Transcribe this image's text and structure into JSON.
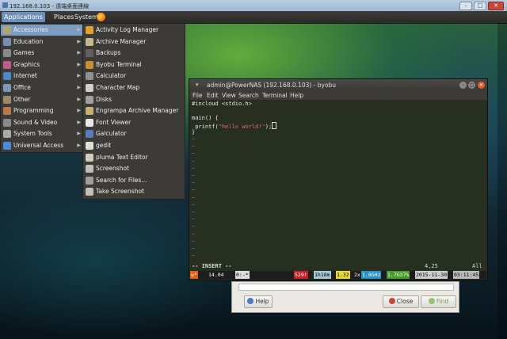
{
  "window": {
    "title": "192.168.0.103 - 遠端桌面連線"
  },
  "top_panel": {
    "applications": "Applications",
    "places": "Places",
    "system": "System"
  },
  "menu": {
    "categories": [
      {
        "label": "Accessories",
        "icon": "accessories-icon",
        "color": "#b0a27a"
      },
      {
        "label": "Education",
        "icon": "education-icon",
        "color": "#7a8fb0"
      },
      {
        "label": "Games",
        "icon": "games-icon",
        "color": "#8a8a8a"
      },
      {
        "label": "Graphics",
        "icon": "graphics-icon",
        "color": "#c05a8a"
      },
      {
        "label": "Internet",
        "icon": "internet-icon",
        "color": "#4a8ac8"
      },
      {
        "label": "Office",
        "icon": "office-icon",
        "color": "#7a9ab8"
      },
      {
        "label": "Other",
        "icon": "other-icon",
        "color": "#9a8a6a"
      },
      {
        "label": "Programming",
        "icon": "programming-icon",
        "color": "#b87a4a"
      },
      {
        "label": "Sound & Video",
        "icon": "sound-video-icon",
        "color": "#8a8a8a"
      },
      {
        "label": "System Tools",
        "icon": "system-tools-icon",
        "color": "#aaaaaa"
      },
      {
        "label": "Universal Access",
        "icon": "universal-access-icon",
        "color": "#4a8ad8"
      }
    ],
    "accessories": [
      {
        "label": "Activity Log Manager",
        "icon": "activity-log-icon",
        "color": "#e0a030"
      },
      {
        "label": "Archive Manager",
        "icon": "archive-icon",
        "color": "#c8b890"
      },
      {
        "label": "Backups",
        "icon": "backups-icon",
        "color": "#606060"
      },
      {
        "label": "Byobu Terminal",
        "icon": "terminal-icon",
        "color": "#c89030"
      },
      {
        "label": "Calculator",
        "icon": "calculator-icon",
        "color": "#909090"
      },
      {
        "label": "Character Map",
        "icon": "character-map-icon",
        "color": "#d0d0d0"
      },
      {
        "label": "Disks",
        "icon": "disks-icon",
        "color": "#a0a0a0"
      },
      {
        "label": "Engrampa Archive Manager",
        "icon": "engrampa-icon",
        "color": "#c8b070"
      },
      {
        "label": "Font Viewer",
        "icon": "font-viewer-icon",
        "color": "#e8e8e8"
      },
      {
        "label": "Galculator",
        "icon": "galculator-icon",
        "color": "#5a7ab8"
      },
      {
        "label": "gedit",
        "icon": "gedit-icon",
        "color": "#e0e0d0"
      },
      {
        "label": "pluma Text Editor",
        "icon": "pluma-icon",
        "color": "#d0d0c0"
      },
      {
        "label": "Screenshot",
        "icon": "screenshot-icon",
        "color": "#c0c0c0"
      },
      {
        "label": "Search for Files...",
        "icon": "search-files-icon",
        "color": "#a0a0a0"
      },
      {
        "label": "Take Screenshot",
        "icon": "take-screenshot-icon",
        "color": "#c0c0c0"
      }
    ]
  },
  "terminal": {
    "title": "admin@PowerNAS (192.168.0.103) - byobu",
    "menus": [
      "File",
      "Edit",
      "View",
      "Search",
      "Terminal",
      "Help"
    ],
    "lines": [
      "#incloud <stdio.h>",
      "",
      "main() {",
      " printf(",
      "\"hello world!\"",
      ");",
      "}"
    ],
    "mode": "-- INSERT --",
    "position": "4,25",
    "scroll": "All",
    "status": {
      "distro": "u⁸",
      "version": "14.04",
      "session": "0:-*",
      "load": "529!",
      "uptime": "1h18m",
      "loadavg": "1.32",
      "cpu_count": "2x",
      "cpu_freq": "1.8GHz",
      "memory": "1.7G37%",
      "date": "2015-11-30",
      "time": "03:11:45"
    }
  },
  "dialog": {
    "help": "Help",
    "close": "Close",
    "find": "Find"
  }
}
